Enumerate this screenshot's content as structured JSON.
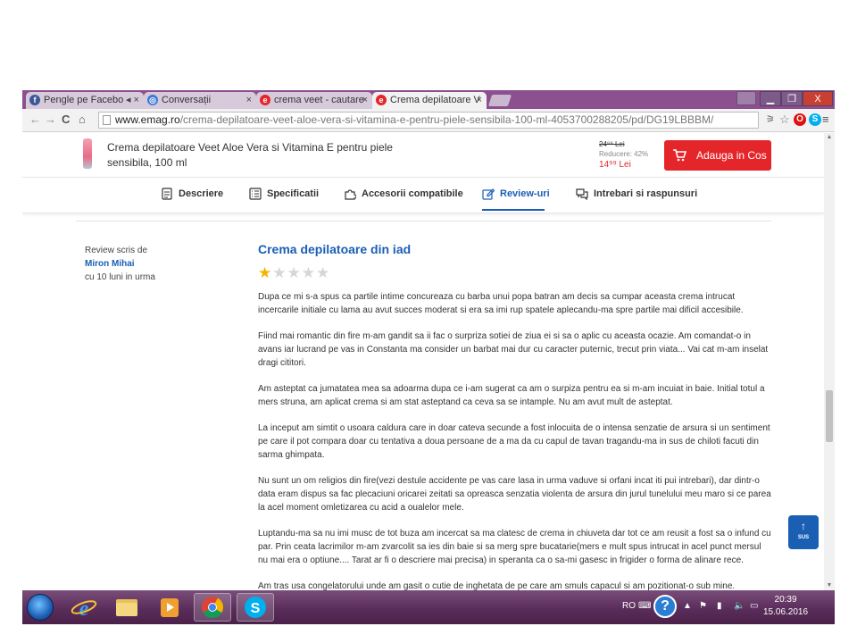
{
  "browser": {
    "tabs": [
      {
        "label": "Pengle pe Facebo",
        "icon_color": "#3b5998",
        "icon": "facebook-icon"
      },
      {
        "label": "Conversații",
        "icon_color": "#3b7bd4",
        "icon": "chat-icon"
      },
      {
        "label": "crema veet - cautare",
        "icon_color": "#e4262b",
        "icon": "emag-icon"
      },
      {
        "label": "Crema depilatoare V",
        "icon_color": "#e4262b",
        "icon": "emag-icon"
      }
    ],
    "url_host": "www.emag.ro",
    "url_path": "/crema-depilatoare-veet-aloe-vera-si-vitamina-e-pentru-piele-sensibila-100-ml-4053700288205/pd/DG19LBBBM/",
    "window_buttons": {
      "min": "▁",
      "max": "❐",
      "close": "X"
    }
  },
  "product": {
    "name": "Crema depilatoare Veet Aloe Vera si Vitamina E pentru piele sensibila, 100 ml",
    "old_price": "24⁹⁹ Lei",
    "discount": "Reducere: 42%",
    "new_price": "14⁹⁹ Lei",
    "cart_button": "Adauga in Cos"
  },
  "nav": {
    "items": [
      "Descriere",
      "Specificatii",
      "Accesorii compatibile",
      "Review-uri",
      "Intrebari si raspunsuri"
    ],
    "active_index": 3,
    "accent_color": "#1a5fb4"
  },
  "review": {
    "written_by": "Review scris de",
    "author": "Miron Mihai",
    "when": "cu 10 luni in urma",
    "title": "Crema depilatoare din iad",
    "rating": 1,
    "rating_max": 5,
    "paragraphs": [
      "Dupa ce mi s-a spus ca partile intime concureaza cu barba unui popa batran am decis sa cumpar aceasta crema intrucat incercarile initiale cu lama au avut succes moderat si era sa imi rup spatele aplecandu-ma spre partile mai dificil accesibile.",
      "Fiind mai romantic din fire m-am gandit sa ii fac o surpriza sotiei de ziua ei si sa o aplic cu aceasta ocazie. Am comandat-o in avans iar lucrand pe vas in Constanta ma consider un barbat mai dur cu caracter puternic, trecut prin viata... Vai cat m-am inselat dragi cititori.",
      "Am asteptat ca jumatatea mea sa adoarma dupa ce i-am sugerat ca am o surpiza pentru ea si m-am incuiat in baie. Initial totul a mers struna, am aplicat crema si am stat asteptand ca ceva sa se intample. Nu am avut mult de asteptat.",
      "La inceput am simtit o usoara caldura care in doar cateva secunde a fost inlocuita de o intensa senzatie de arsura si un sentiment pe care il pot compara doar cu tentativa a doua persoane de a ma da cu capul de tavan tragandu-ma in sus de chiloti facuti din sarma ghimpata.",
      "Nu sunt un om religios din fire(vezi destule accidente pe vas care lasa in urma vaduve si orfani incat iti pui intrebari), dar dintr-o data eram dispus sa fac plecaciuni oricarei zeitati sa opreasca senzatia violenta de arsura din jurul tunelului meu maro si ce parea la acel moment omletizarea cu acid a oualelor mele.",
      "Luptandu-ma sa nu imi musc de tot buza am incercat sa ma clatesc de crema in chiuveta dar tot ce am reusit a fost sa o infund cu par. Prin ceata lacrimilor m-am zvarcolit sa ies din baie si sa merg spre bucatarie(mers e mult spus intrucat in acel punct mersul nu mai era o optiune.... Tarat ar fi o descriere mai precisa) in speranta ca o sa-mi gasesc in frigider o forma de alinare rece.",
      "Am tras usa congelatorului unde am gasit o cutie de inghetata de pe care am smuls capacul si am pozitionat-o sub mine."
    ]
  },
  "sub_button": {
    "arrow": "↑",
    "label": "SUS"
  },
  "taskbar": {
    "language": "RO",
    "time": "20:39",
    "date": "15.06.2016"
  }
}
